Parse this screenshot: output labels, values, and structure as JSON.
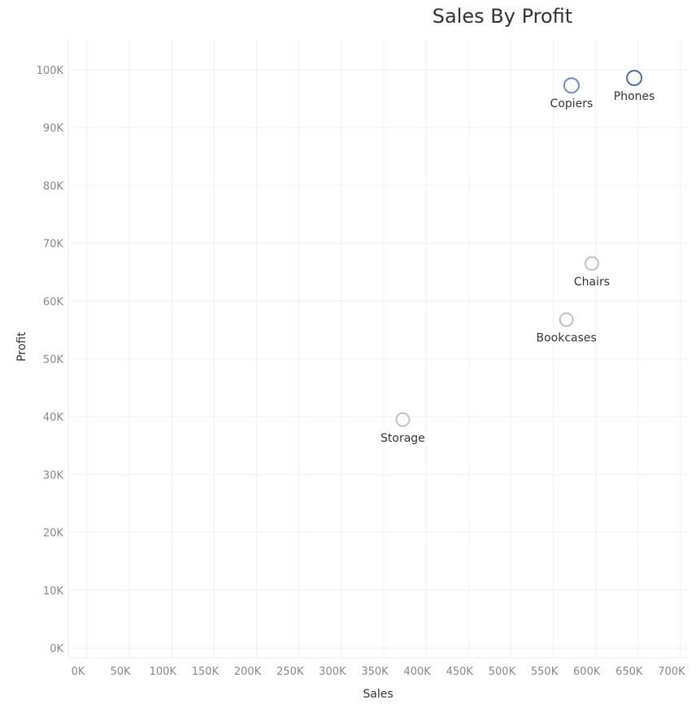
{
  "chart_data": {
    "type": "scatter",
    "title": "Sales By Profit",
    "xlabel": "Sales",
    "ylabel": "Profit",
    "xlim": [
      0,
      700000
    ],
    "ylim": [
      0,
      100000
    ],
    "xticks": [
      0,
      50000,
      100000,
      150000,
      200000,
      250000,
      300000,
      350000,
      400000,
      450000,
      500000,
      550000,
      600000,
      650000,
      700000
    ],
    "xtick_labels": [
      "0K",
      "50K",
      "100K",
      "150K",
      "200K",
      "250K",
      "300K",
      "350K",
      "400K",
      "450K",
      "500K",
      "550K",
      "600K",
      "650K",
      "700K"
    ],
    "yticks": [
      0,
      10000,
      20000,
      30000,
      40000,
      50000,
      60000,
      70000,
      80000,
      90000,
      100000
    ],
    "ytick_labels": [
      "0K",
      "10K",
      "20K",
      "30K",
      "40K",
      "50K",
      "60K",
      "70K",
      "80K",
      "90K",
      "100K"
    ],
    "grid": true,
    "points": [
      {
        "label": "Phones",
        "x": 656000,
        "y": 98600,
        "color": "#4e6f9c"
      },
      {
        "label": "Copiers",
        "x": 582000,
        "y": 97300,
        "color": "#6f8fb5"
      },
      {
        "label": "Chairs",
        "x": 606000,
        "y": 66500,
        "color": "#c6c0bd"
      },
      {
        "label": "Bookcases",
        "x": 576000,
        "y": 56800,
        "color": "#c6c0bd"
      },
      {
        "label": "Storage",
        "x": 383000,
        "y": 39500,
        "color": "#c6c0bd"
      }
    ]
  }
}
